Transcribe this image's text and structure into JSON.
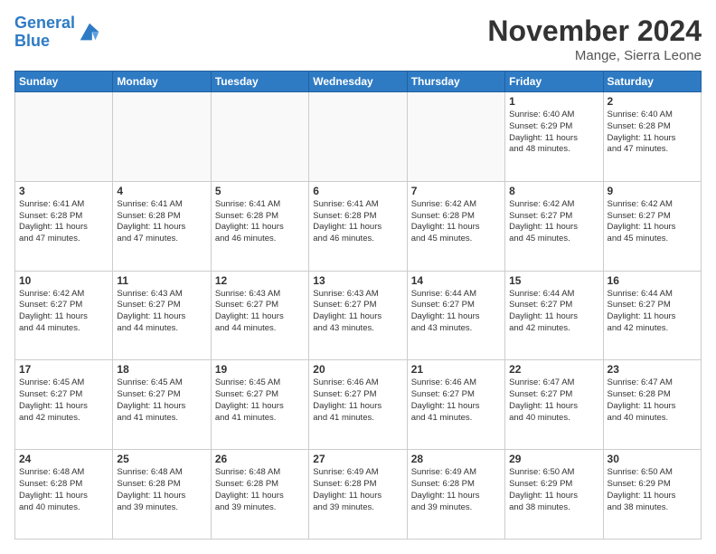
{
  "header": {
    "logo_line1": "General",
    "logo_line2": "Blue",
    "month_title": "November 2024",
    "location": "Mange, Sierra Leone"
  },
  "days_of_week": [
    "Sunday",
    "Monday",
    "Tuesday",
    "Wednesday",
    "Thursday",
    "Friday",
    "Saturday"
  ],
  "weeks": [
    [
      {
        "day": "",
        "text": ""
      },
      {
        "day": "",
        "text": ""
      },
      {
        "day": "",
        "text": ""
      },
      {
        "day": "",
        "text": ""
      },
      {
        "day": "",
        "text": ""
      },
      {
        "day": "1",
        "text": "Sunrise: 6:40 AM\nSunset: 6:29 PM\nDaylight: 11 hours\nand 48 minutes."
      },
      {
        "day": "2",
        "text": "Sunrise: 6:40 AM\nSunset: 6:28 PM\nDaylight: 11 hours\nand 47 minutes."
      }
    ],
    [
      {
        "day": "3",
        "text": "Sunrise: 6:41 AM\nSunset: 6:28 PM\nDaylight: 11 hours\nand 47 minutes."
      },
      {
        "day": "4",
        "text": "Sunrise: 6:41 AM\nSunset: 6:28 PM\nDaylight: 11 hours\nand 47 minutes."
      },
      {
        "day": "5",
        "text": "Sunrise: 6:41 AM\nSunset: 6:28 PM\nDaylight: 11 hours\nand 46 minutes."
      },
      {
        "day": "6",
        "text": "Sunrise: 6:41 AM\nSunset: 6:28 PM\nDaylight: 11 hours\nand 46 minutes."
      },
      {
        "day": "7",
        "text": "Sunrise: 6:42 AM\nSunset: 6:28 PM\nDaylight: 11 hours\nand 45 minutes."
      },
      {
        "day": "8",
        "text": "Sunrise: 6:42 AM\nSunset: 6:27 PM\nDaylight: 11 hours\nand 45 minutes."
      },
      {
        "day": "9",
        "text": "Sunrise: 6:42 AM\nSunset: 6:27 PM\nDaylight: 11 hours\nand 45 minutes."
      }
    ],
    [
      {
        "day": "10",
        "text": "Sunrise: 6:42 AM\nSunset: 6:27 PM\nDaylight: 11 hours\nand 44 minutes."
      },
      {
        "day": "11",
        "text": "Sunrise: 6:43 AM\nSunset: 6:27 PM\nDaylight: 11 hours\nand 44 minutes."
      },
      {
        "day": "12",
        "text": "Sunrise: 6:43 AM\nSunset: 6:27 PM\nDaylight: 11 hours\nand 44 minutes."
      },
      {
        "day": "13",
        "text": "Sunrise: 6:43 AM\nSunset: 6:27 PM\nDaylight: 11 hours\nand 43 minutes."
      },
      {
        "day": "14",
        "text": "Sunrise: 6:44 AM\nSunset: 6:27 PM\nDaylight: 11 hours\nand 43 minutes."
      },
      {
        "day": "15",
        "text": "Sunrise: 6:44 AM\nSunset: 6:27 PM\nDaylight: 11 hours\nand 42 minutes."
      },
      {
        "day": "16",
        "text": "Sunrise: 6:44 AM\nSunset: 6:27 PM\nDaylight: 11 hours\nand 42 minutes."
      }
    ],
    [
      {
        "day": "17",
        "text": "Sunrise: 6:45 AM\nSunset: 6:27 PM\nDaylight: 11 hours\nand 42 minutes."
      },
      {
        "day": "18",
        "text": "Sunrise: 6:45 AM\nSunset: 6:27 PM\nDaylight: 11 hours\nand 41 minutes."
      },
      {
        "day": "19",
        "text": "Sunrise: 6:45 AM\nSunset: 6:27 PM\nDaylight: 11 hours\nand 41 minutes."
      },
      {
        "day": "20",
        "text": "Sunrise: 6:46 AM\nSunset: 6:27 PM\nDaylight: 11 hours\nand 41 minutes."
      },
      {
        "day": "21",
        "text": "Sunrise: 6:46 AM\nSunset: 6:27 PM\nDaylight: 11 hours\nand 41 minutes."
      },
      {
        "day": "22",
        "text": "Sunrise: 6:47 AM\nSunset: 6:27 PM\nDaylight: 11 hours\nand 40 minutes."
      },
      {
        "day": "23",
        "text": "Sunrise: 6:47 AM\nSunset: 6:28 PM\nDaylight: 11 hours\nand 40 minutes."
      }
    ],
    [
      {
        "day": "24",
        "text": "Sunrise: 6:48 AM\nSunset: 6:28 PM\nDaylight: 11 hours\nand 40 minutes."
      },
      {
        "day": "25",
        "text": "Sunrise: 6:48 AM\nSunset: 6:28 PM\nDaylight: 11 hours\nand 39 minutes."
      },
      {
        "day": "26",
        "text": "Sunrise: 6:48 AM\nSunset: 6:28 PM\nDaylight: 11 hours\nand 39 minutes."
      },
      {
        "day": "27",
        "text": "Sunrise: 6:49 AM\nSunset: 6:28 PM\nDaylight: 11 hours\nand 39 minutes."
      },
      {
        "day": "28",
        "text": "Sunrise: 6:49 AM\nSunset: 6:28 PM\nDaylight: 11 hours\nand 39 minutes."
      },
      {
        "day": "29",
        "text": "Sunrise: 6:50 AM\nSunset: 6:29 PM\nDaylight: 11 hours\nand 38 minutes."
      },
      {
        "day": "30",
        "text": "Sunrise: 6:50 AM\nSunset: 6:29 PM\nDaylight: 11 hours\nand 38 minutes."
      }
    ]
  ]
}
